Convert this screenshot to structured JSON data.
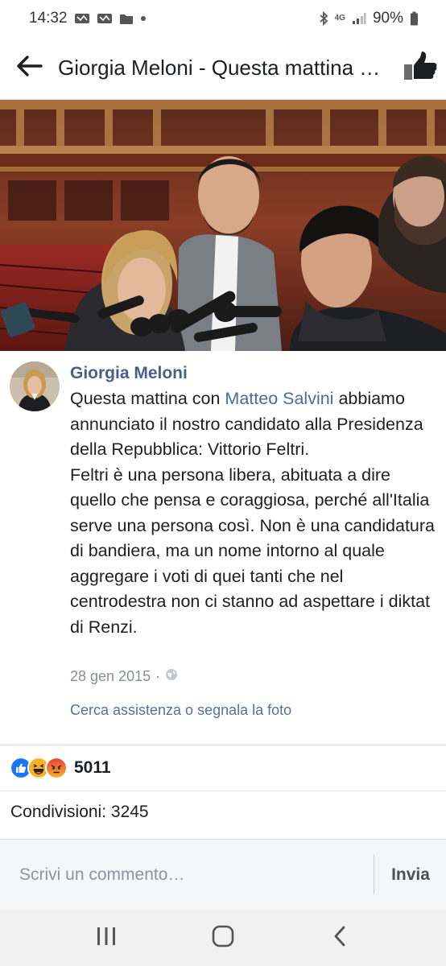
{
  "status_bar": {
    "time": "14:32",
    "network": "4G",
    "battery": "90%",
    "icons": [
      "notification-icon",
      "notification-icon",
      "folder-icon",
      "dot-icon",
      "bluetooth-icon",
      "signal-icon",
      "battery-icon"
    ]
  },
  "app_bar": {
    "title": "Giorgia Meloni - Questa mattina con Matteo Salvini",
    "back_icon": "arrow-left-icon",
    "like_icon": "thumbs-up-icon"
  },
  "post": {
    "author": "Giorgia Meloni",
    "text_intro": "Questa mattina con ",
    "mention": "Matteo Salvini",
    "text_rest": " abbiamo annunciato il nostro candidato alla Presidenza della Repubblica: Vittorio Feltri.",
    "paragraph2": "Feltri è una persona libera, abituata a dire quello che pensa e coraggiosa, perché all'Italia serve una persona così. Non è una candidatura di bandiera, ma un nome intorno al quale aggregare i voti di quei tanti che nel centrodestra non ci stanno ad aspettare i diktat di Renzi.",
    "date": "28 gen 2015",
    "date_separator": "·",
    "privacy_icon": "globe-icon",
    "report_link": "Cerca assistenza o segnala la foto"
  },
  "reactions": {
    "icons": [
      "like-reaction-icon",
      "haha-reaction-icon",
      "angry-reaction-icon"
    ],
    "count": "5011"
  },
  "shares": {
    "label": "Condivisioni: 3245"
  },
  "comment": {
    "placeholder": "Scrivi un commento…",
    "send_label": "Invia"
  },
  "nav": {
    "icons": [
      "recent-apps-icon",
      "home-icon",
      "back-icon"
    ]
  },
  "colors": {
    "author": "#4b5d8a",
    "mention": "#4b6a9e",
    "link": "#52719e",
    "like": "#1877f2",
    "haha": "#f7b125",
    "angry": "#e9710f"
  }
}
